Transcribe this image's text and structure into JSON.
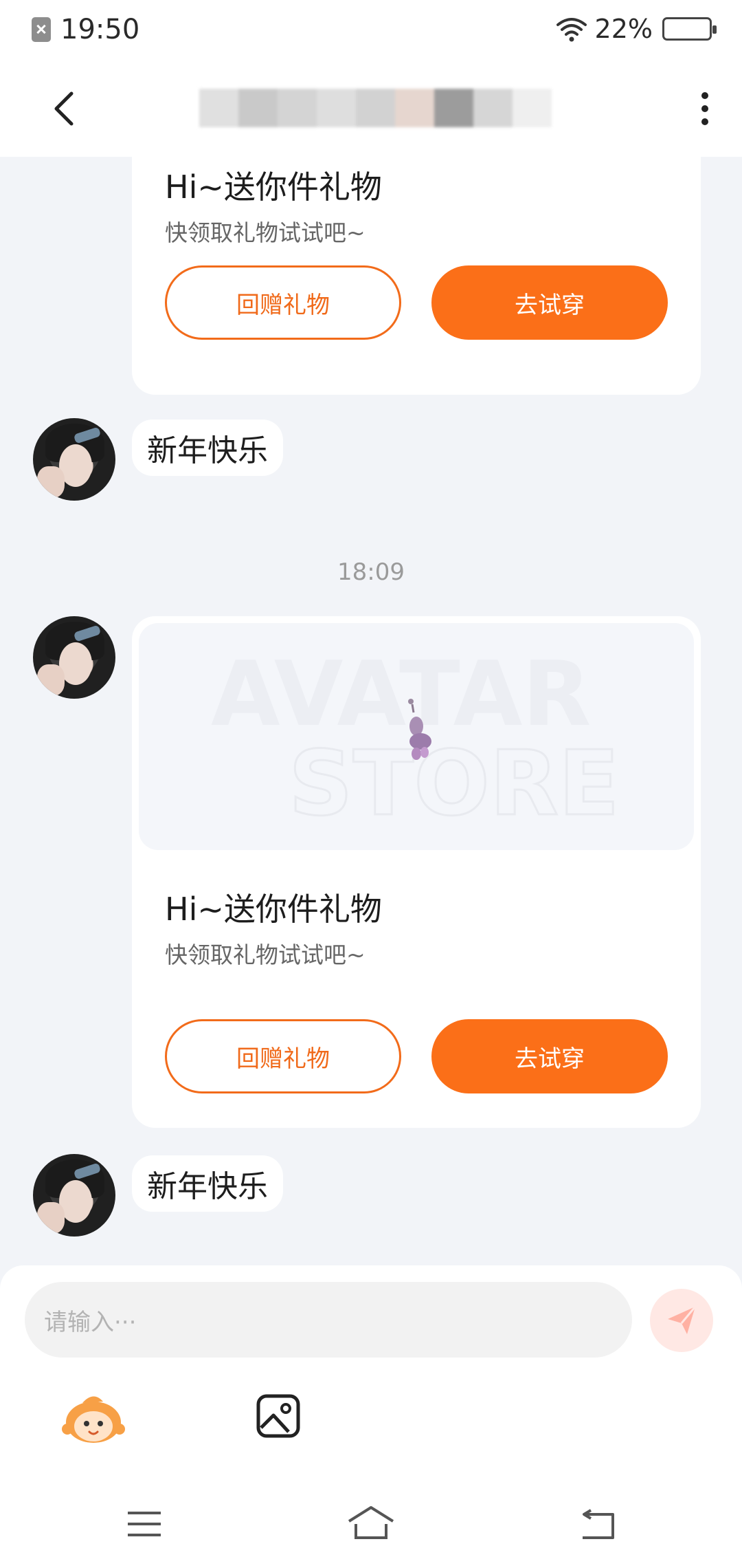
{
  "status_bar": {
    "time": "19:50",
    "battery": "22%",
    "battery_level": 0.22
  },
  "header": {
    "back_icon": "chevron-left-icon",
    "more_icon": "more-vertical-icon"
  },
  "gift_cards": [
    {
      "title": "Hi~送你件礼物",
      "subtitle": "快领取礼物试试吧~",
      "return_label": "回赠礼物",
      "try_label": "去试穿"
    },
    {
      "title": "Hi~送你件礼物",
      "subtitle": "快领取礼物试试吧~",
      "return_label": "回赠礼物",
      "try_label": "去试穿",
      "image_watermark_1": "AVATAR",
      "image_watermark_2": "STORE"
    }
  ],
  "messages": [
    {
      "text": "新年快乐"
    },
    {
      "text": "新年快乐"
    }
  ],
  "timestamp": "18:09",
  "input": {
    "placeholder": "请输入···"
  },
  "colors": {
    "accent": "#fb6f18",
    "background": "#f2f4f8"
  }
}
